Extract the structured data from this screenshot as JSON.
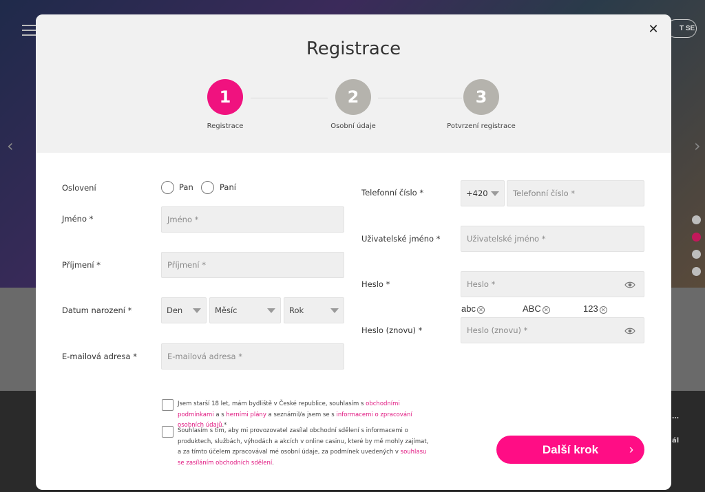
{
  "background": {
    "login_button_label": "T SE",
    "side_text_1": "…",
    "side_text_2": "ál"
  },
  "modal": {
    "title": "Registrace",
    "close_icon": "close-icon",
    "steps": [
      {
        "number": "1",
        "label": "Registrace",
        "active": true
      },
      {
        "number": "2",
        "label": "Osobní údaje",
        "active": false
      },
      {
        "number": "3",
        "label": "Potvrzení registrace",
        "active": false
      }
    ],
    "colors": {
      "accent": "#ff0d85",
      "step_inactive": "#b5b3ad"
    }
  },
  "form": {
    "salutation": {
      "label": "Oslovení",
      "options": [
        "Pan",
        "Paní"
      ]
    },
    "first_name": {
      "label": "Jméno *",
      "placeholder": "Jméno *"
    },
    "last_name": {
      "label": "Příjmení *",
      "placeholder": "Příjmení *"
    },
    "birth_date": {
      "label": "Datum narození *",
      "day": "Den",
      "month": "Měsíc",
      "year": "Rok"
    },
    "email": {
      "label": "E-mailová adresa *",
      "placeholder": "E-mailová adresa *"
    },
    "phone": {
      "label": "Telefonní číslo *",
      "prefix": "+420",
      "placeholder": "Telefonní číslo *"
    },
    "username": {
      "label": "Uživatelské jméno *",
      "placeholder": "Uživatelské jméno *"
    },
    "password": {
      "label": "Heslo *",
      "placeholder": "Heslo *"
    },
    "password_rules": [
      "abc",
      "ABC",
      "123"
    ],
    "password_repeat": {
      "label": "Heslo (znovu) *",
      "placeholder": "Heslo (znovu) *"
    }
  },
  "consents": {
    "first": {
      "text_a": "Jsem starší 18 let, mám bydliště v České republice, souhlasím s ",
      "link_a": "obchodními podmínkami",
      "text_b": " a s ",
      "link_b": "herními plány",
      "text_c": " a seznámil/a jsem se s ",
      "link_c": "informacemi o zpracování osobních údajů",
      "text_d": ".*"
    },
    "second": {
      "text_a": "Souhlasím s tím, aby mi provozovatel zasílal obchodní sdělení s informacemi o produktech, službách, výhodách a akcích v online casinu, které by mě mohly zajímat, a za tímto účelem zpracovával mé osobní údaje, za podmínek uvedených v ",
      "link_a": "souhlasu se zasíláním obchodních sdělení",
      "text_b": "."
    }
  },
  "next_button": {
    "label": "Další krok",
    "icon": "chevron-right-icon"
  }
}
